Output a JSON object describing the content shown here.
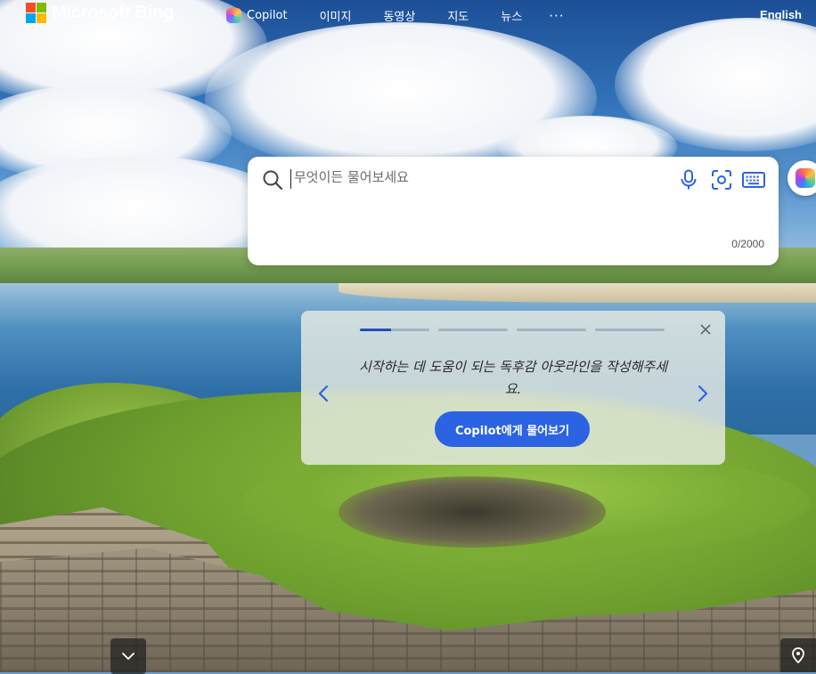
{
  "brand": {
    "name": "Microsoft Bing",
    "logo_colors": [
      "#f25022",
      "#7fba00",
      "#00a4ef",
      "#ffb900"
    ]
  },
  "nav": {
    "items": [
      {
        "label": "Copilot",
        "icon": "copilot-icon"
      },
      {
        "label": "이미지"
      },
      {
        "label": "동영상"
      },
      {
        "label": "지도"
      },
      {
        "label": "뉴스"
      }
    ],
    "more_label": "···",
    "language": "English"
  },
  "search": {
    "placeholder": "무엇이든 물어보세요",
    "char_count": "0/2000",
    "icons": [
      "microphone-icon",
      "visual-search-icon",
      "keyboard-icon"
    ]
  },
  "suggestion_card": {
    "progress": [
      1.0,
      0,
      0,
      0
    ],
    "progress_of_first": 0.45,
    "message": "시작하는 데 도움이 되는 독후감 아웃라인을 작성해주세요.",
    "button_label": "Copilot에게 물어보기",
    "accent": "#2b63e3"
  },
  "footer": {
    "icons": [
      "chevron-down-icon",
      "location-pin-icon"
    ]
  }
}
